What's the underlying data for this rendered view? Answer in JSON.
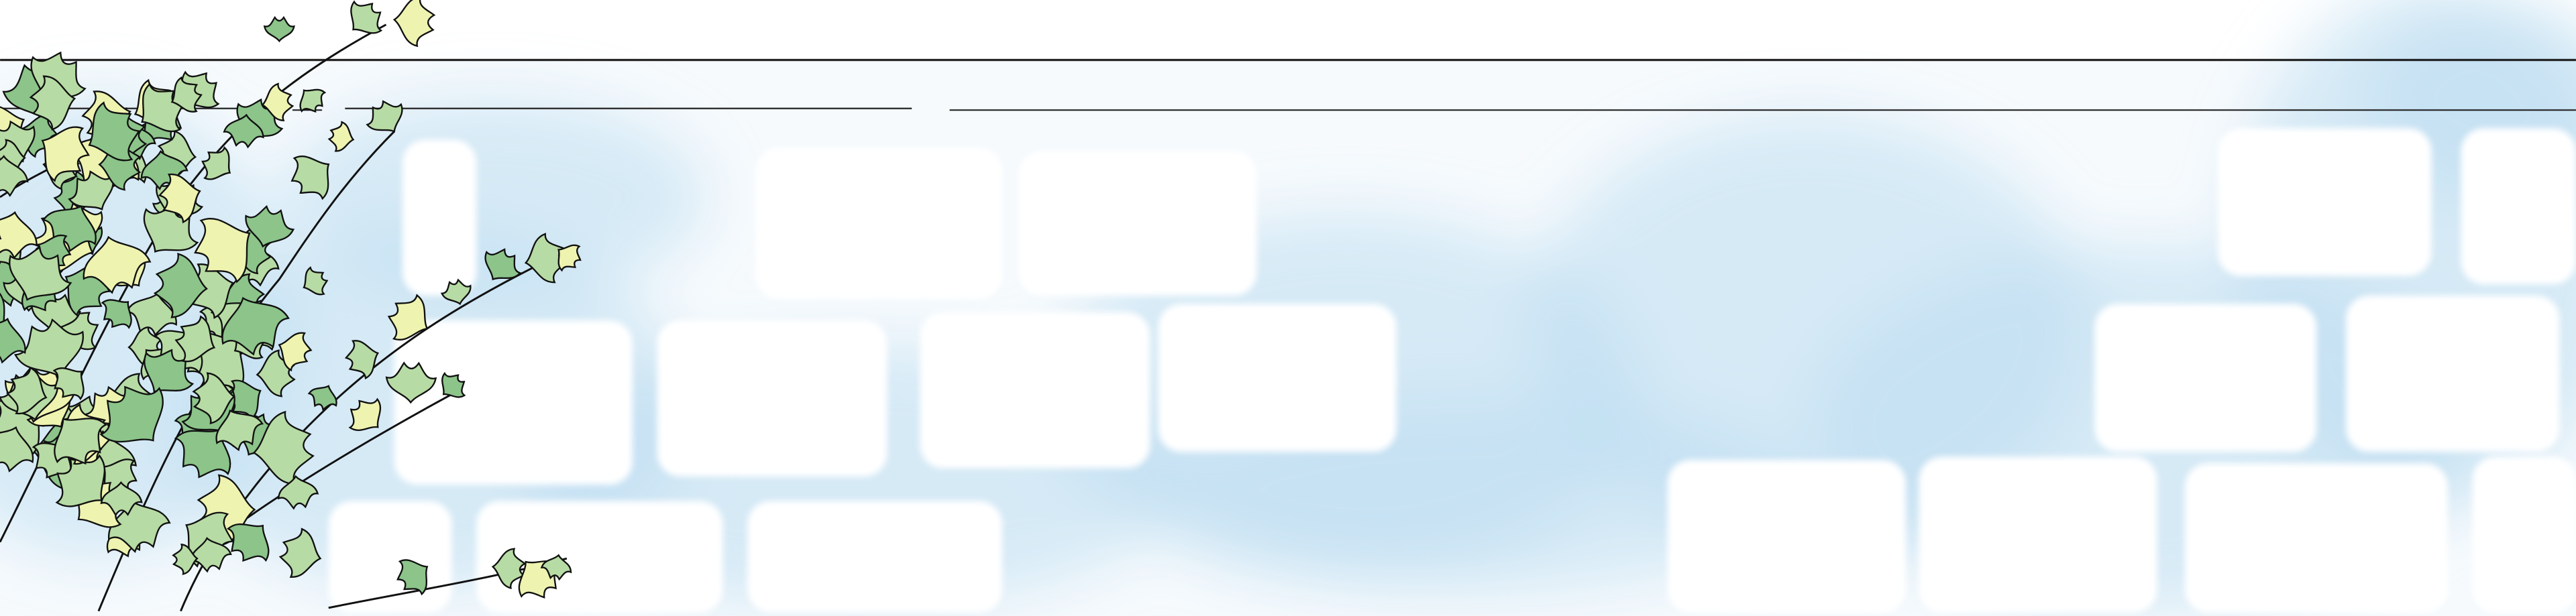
{
  "banner": {
    "colors": {
      "background": "#ffffff",
      "wash": "#bcdcf0",
      "wash_light": "#e3f0f8",
      "brick": "#ffffff",
      "line": "#1a1a1a",
      "leaf_dark": "#8cc48a",
      "leaf_mid": "#b7dba4",
      "leaf_light": "#eef3b0",
      "outline": "#111111"
    },
    "icons": [
      "ivy-vine-illustration",
      "brick-wall-illustration"
    ]
  }
}
